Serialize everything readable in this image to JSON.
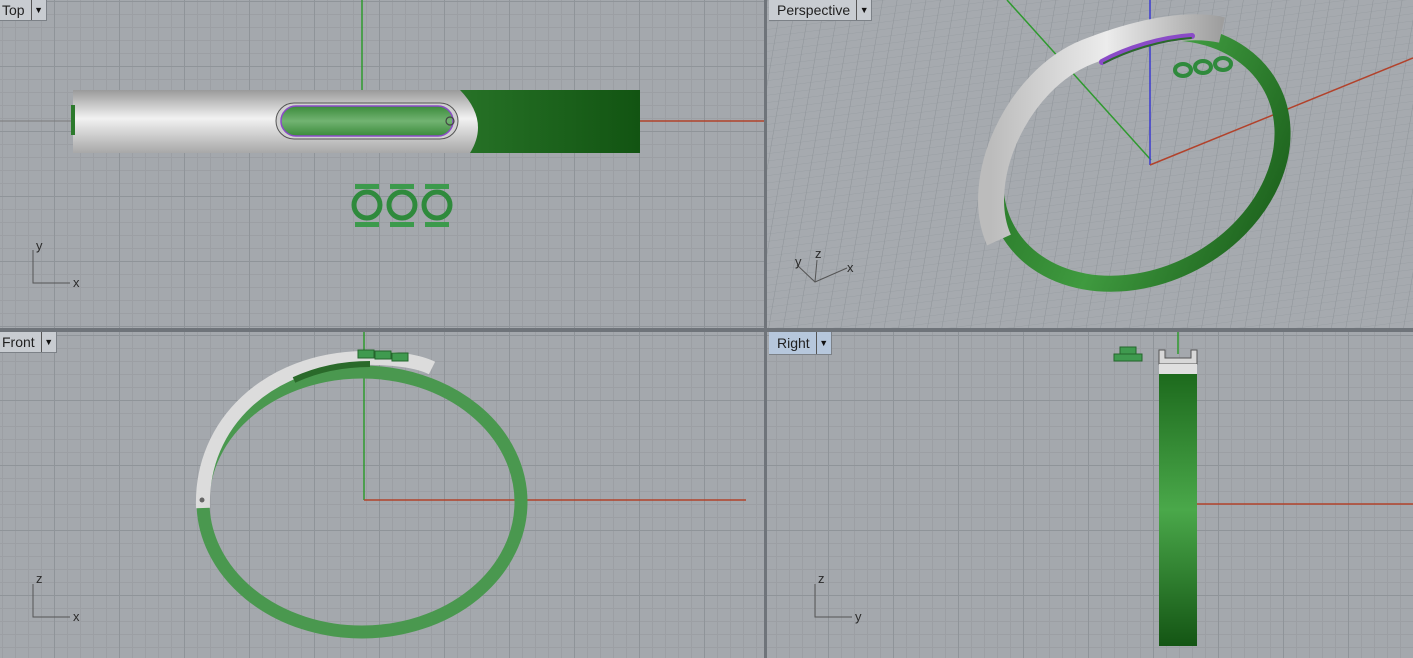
{
  "viewports": {
    "top": {
      "label": "Top",
      "axes": {
        "h": "x",
        "v": "y"
      }
    },
    "perspective": {
      "label": "Perspective",
      "axes": {
        "a": "y",
        "b": "z",
        "c": "x"
      }
    },
    "front": {
      "label": "Front",
      "axes": {
        "h": "x",
        "v": "z"
      }
    },
    "right": {
      "label": "Right",
      "axes": {
        "h": "y",
        "v": "z"
      },
      "active": true
    }
  },
  "colors": {
    "grid_background": "#a4a8ad",
    "x_axis": "#b2422b",
    "y_axis": "#2f9a2f",
    "z_axis": "#3a3ad0",
    "model_green": "#3a8a3a",
    "model_silver": "#d9d9d9",
    "model_accent": "#8a4bc7",
    "active_tab": "#b6c7dc"
  }
}
